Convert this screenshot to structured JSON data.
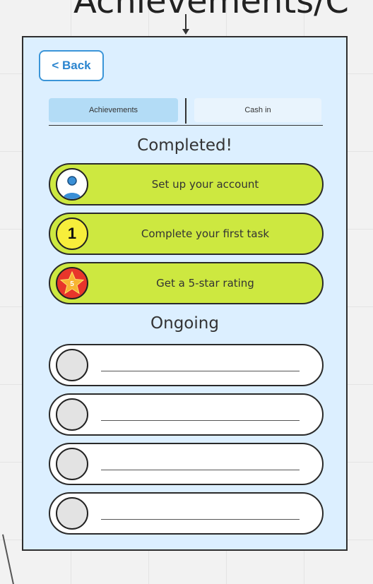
{
  "canvas": {
    "title": "Achievements/C"
  },
  "screen": {
    "back_button": "< Back",
    "tabs": [
      {
        "label": "Achievements",
        "active": true
      },
      {
        "label": "Cash in",
        "active": false
      }
    ],
    "completed": {
      "heading": "Completed!",
      "items": [
        {
          "label": "Set up your account",
          "icon": "user-icon"
        },
        {
          "label": "Complete your first task",
          "icon": "number-one-badge-icon"
        },
        {
          "label": "Get a 5-star rating",
          "icon": "star-badge-icon"
        }
      ]
    },
    "ongoing": {
      "heading": "Ongoing",
      "item_count_visible": 4
    }
  },
  "colors": {
    "frame_background": "#dcefff",
    "completed_pill": "#cde840",
    "back_button": "#2b85cf",
    "active_tab": "#b3dcf6",
    "inactive_tab": "#e9f4fd"
  }
}
